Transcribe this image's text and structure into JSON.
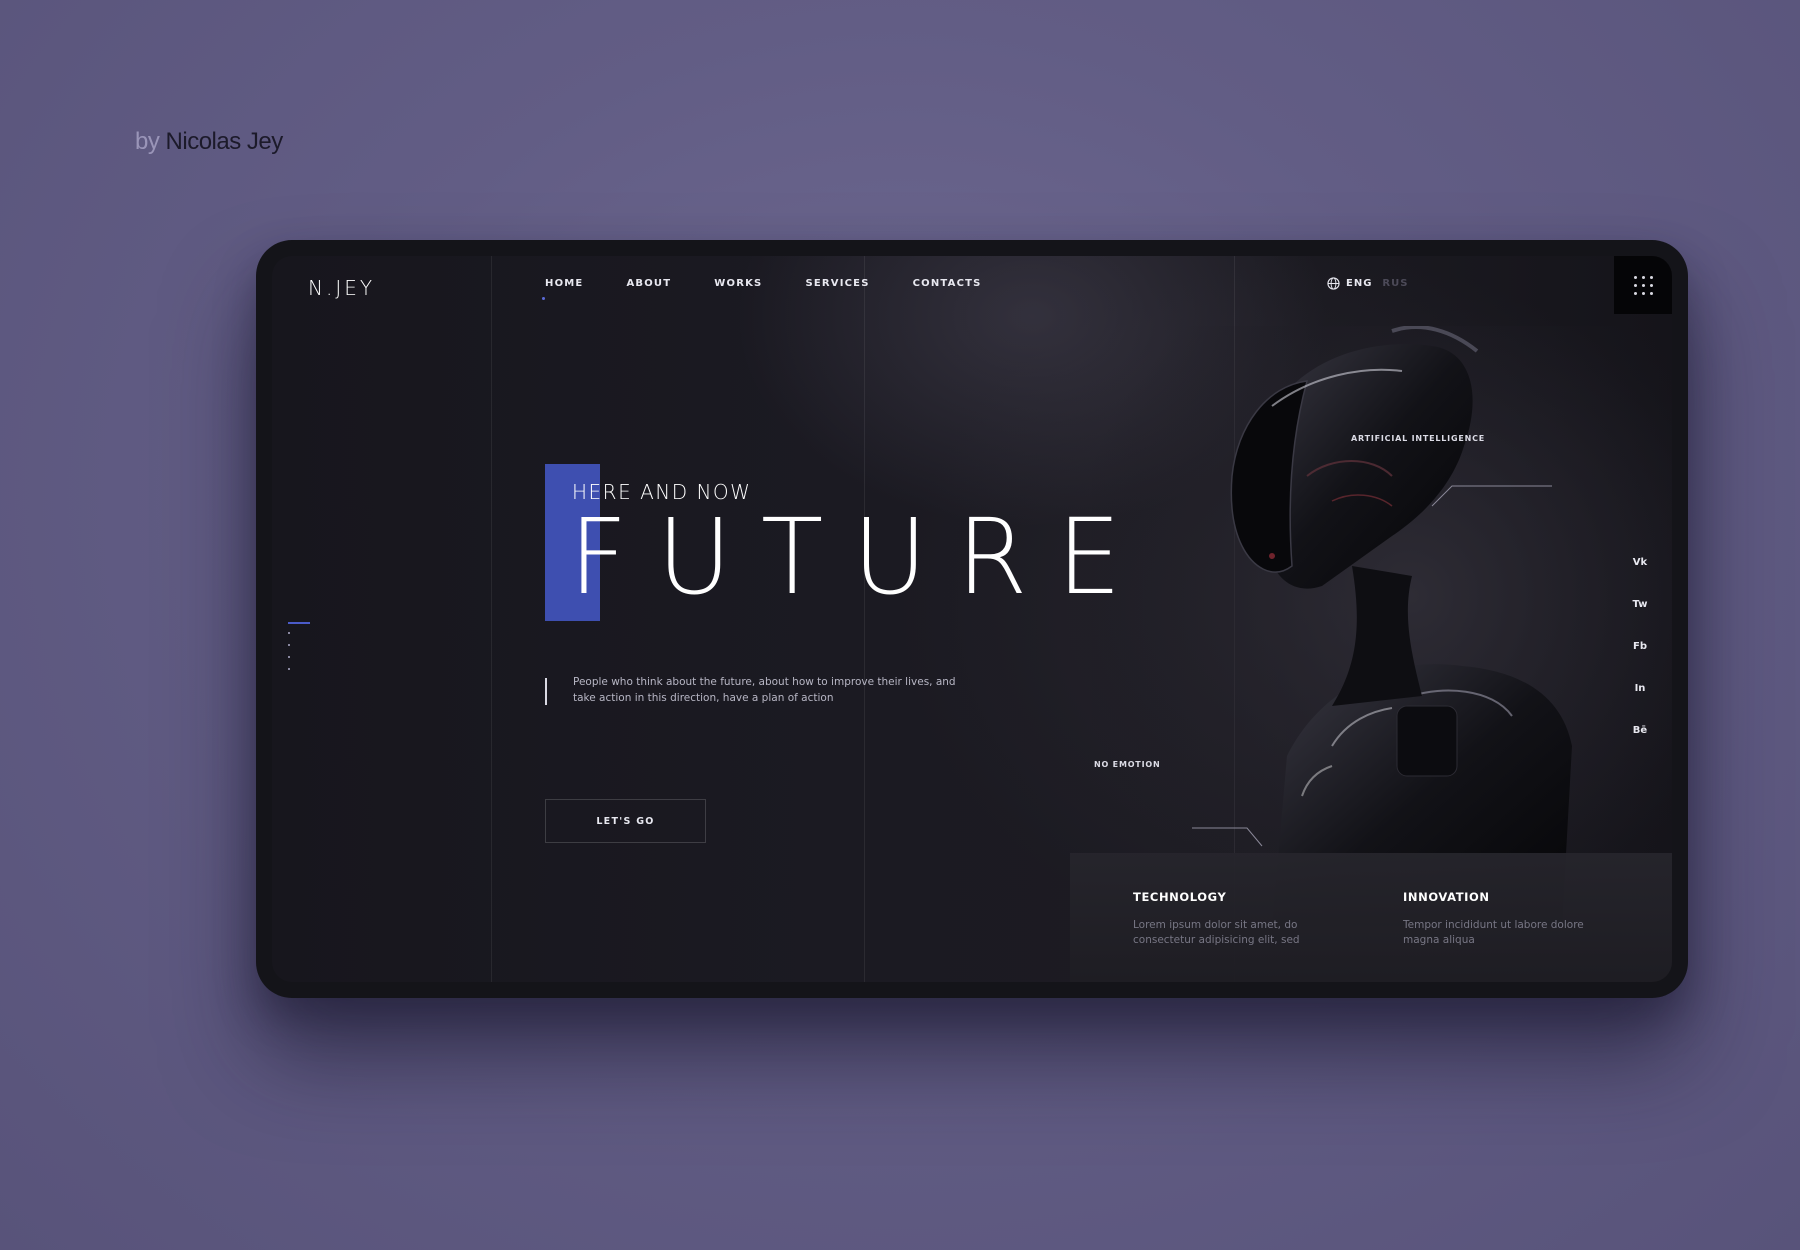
{
  "credit": {
    "prefix": "by",
    "author": "Nicolas Jey"
  },
  "brand": {
    "logo": "N.JEY"
  },
  "nav": {
    "items": [
      {
        "label": "HOME"
      },
      {
        "label": "ABOUT"
      },
      {
        "label": "WORKS"
      },
      {
        "label": "SERVICES"
      },
      {
        "label": "CONTACTS"
      }
    ],
    "active": "HOME"
  },
  "language": {
    "active": "ENG",
    "inactive": "RUS",
    "icon": "globe-icon"
  },
  "menu": {
    "icon": "grid-menu-icon"
  },
  "hero": {
    "kicker": "HERE AND NOW",
    "headline": "FUTURE",
    "description": "People who think about the future, about how to improve their lives, and take action in this direction, have a plan of action",
    "cta": "LET'S GO"
  },
  "annotations": {
    "ai": "ARTIFICIAL INTELLIGENCE",
    "emotion": "NO EMOTION"
  },
  "social": [
    "Vk",
    "Tw",
    "Fb",
    "In",
    "Bē"
  ],
  "features": [
    {
      "title": "TECHNOLOGY",
      "text": "Lorem ipsum dolor sit amet, do consectetur adipisicing elit, sed"
    },
    {
      "title": "INNOVATION",
      "text": "Tempor incididunt ut labore dolore magna aliqua"
    }
  ],
  "colors": {
    "accent": "#3e4fb0",
    "background": "#625d85",
    "screen": "#1b1a22"
  }
}
